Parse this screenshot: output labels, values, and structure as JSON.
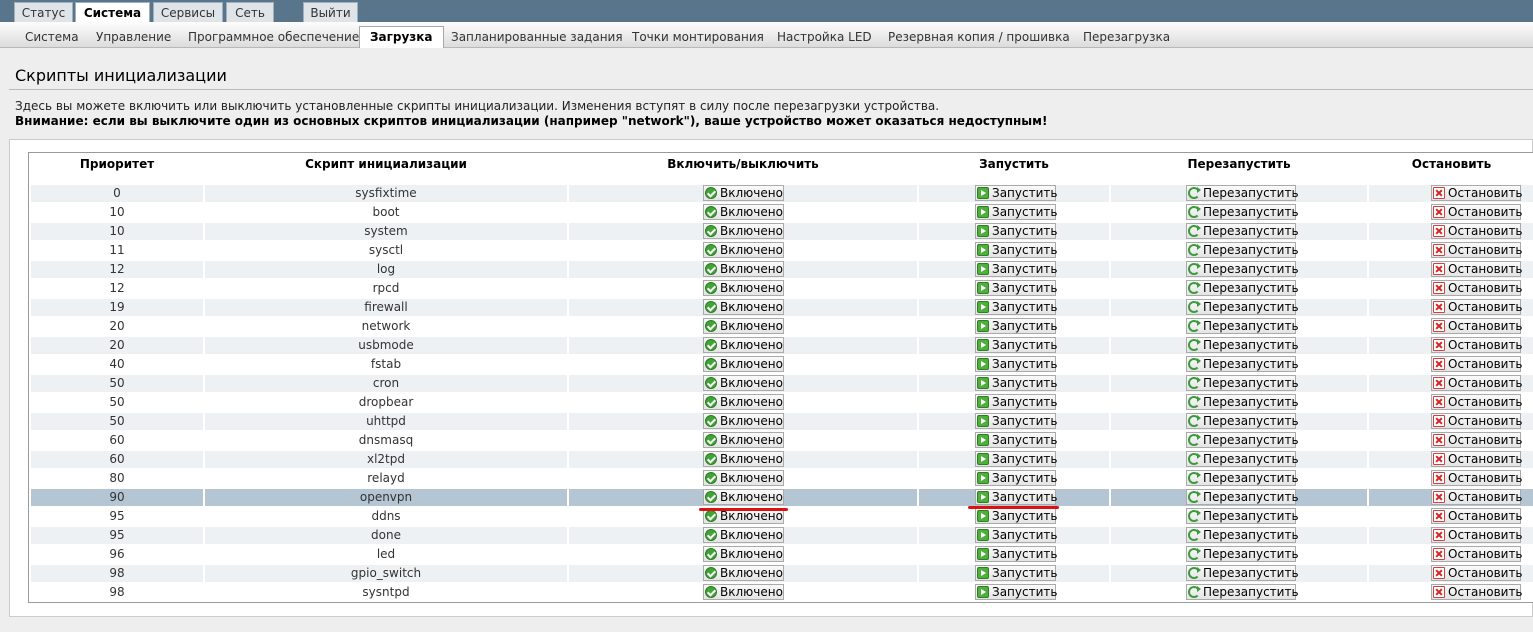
{
  "top_tabs": [
    "Статус",
    "Система",
    "Сервисы",
    "Сеть",
    "Выйти"
  ],
  "sub_tabs": [
    "Система",
    "Управление",
    "Программное обеспечение",
    "Загрузка",
    "Запланированные задания",
    "Точки монтирования",
    "Настройка LED",
    "Резервная копия / прошивка",
    "Перезагрузка"
  ],
  "page": {
    "title": "Скрипты инициализации",
    "description": "Здесь вы можете включить или выключить установленные скрипты инициализации. Изменения вступят в силу после перезагрузки устройства.",
    "warning": "Внимание: если вы выключите один из основных скриптов инициализации (например \"network\"), ваше устройство может оказаться недоступным!"
  },
  "table": {
    "headers": [
      "Приоритет",
      "Скрипт инициализации",
      "Включить/выключить",
      "Запустить",
      "Перезапустить",
      "Остановить"
    ],
    "button_labels": {
      "enabled": "Включено",
      "start": "Запустить",
      "restart": "Перезапустить",
      "stop": "Остановить"
    },
    "rows": [
      {
        "priority": "0",
        "script": "sysfixtime"
      },
      {
        "priority": "10",
        "script": "boot"
      },
      {
        "priority": "10",
        "script": "system"
      },
      {
        "priority": "11",
        "script": "sysctl"
      },
      {
        "priority": "12",
        "script": "log"
      },
      {
        "priority": "12",
        "script": "rpcd"
      },
      {
        "priority": "19",
        "script": "firewall"
      },
      {
        "priority": "20",
        "script": "network"
      },
      {
        "priority": "20",
        "script": "usbmode"
      },
      {
        "priority": "40",
        "script": "fstab"
      },
      {
        "priority": "50",
        "script": "cron"
      },
      {
        "priority": "50",
        "script": "dropbear"
      },
      {
        "priority": "50",
        "script": "uhttpd"
      },
      {
        "priority": "60",
        "script": "dnsmasq"
      },
      {
        "priority": "60",
        "script": "xl2tpd"
      },
      {
        "priority": "80",
        "script": "relayd"
      },
      {
        "priority": "90",
        "script": "openvpn"
      },
      {
        "priority": "95",
        "script": "ddns"
      },
      {
        "priority": "95",
        "script": "done"
      },
      {
        "priority": "96",
        "script": "led"
      },
      {
        "priority": "98",
        "script": "gpio_switch"
      },
      {
        "priority": "98",
        "script": "sysntpd"
      }
    ]
  },
  "colors": {
    "highlight_row": "#b4c5d3",
    "annotation_underline": "#dd1111"
  }
}
